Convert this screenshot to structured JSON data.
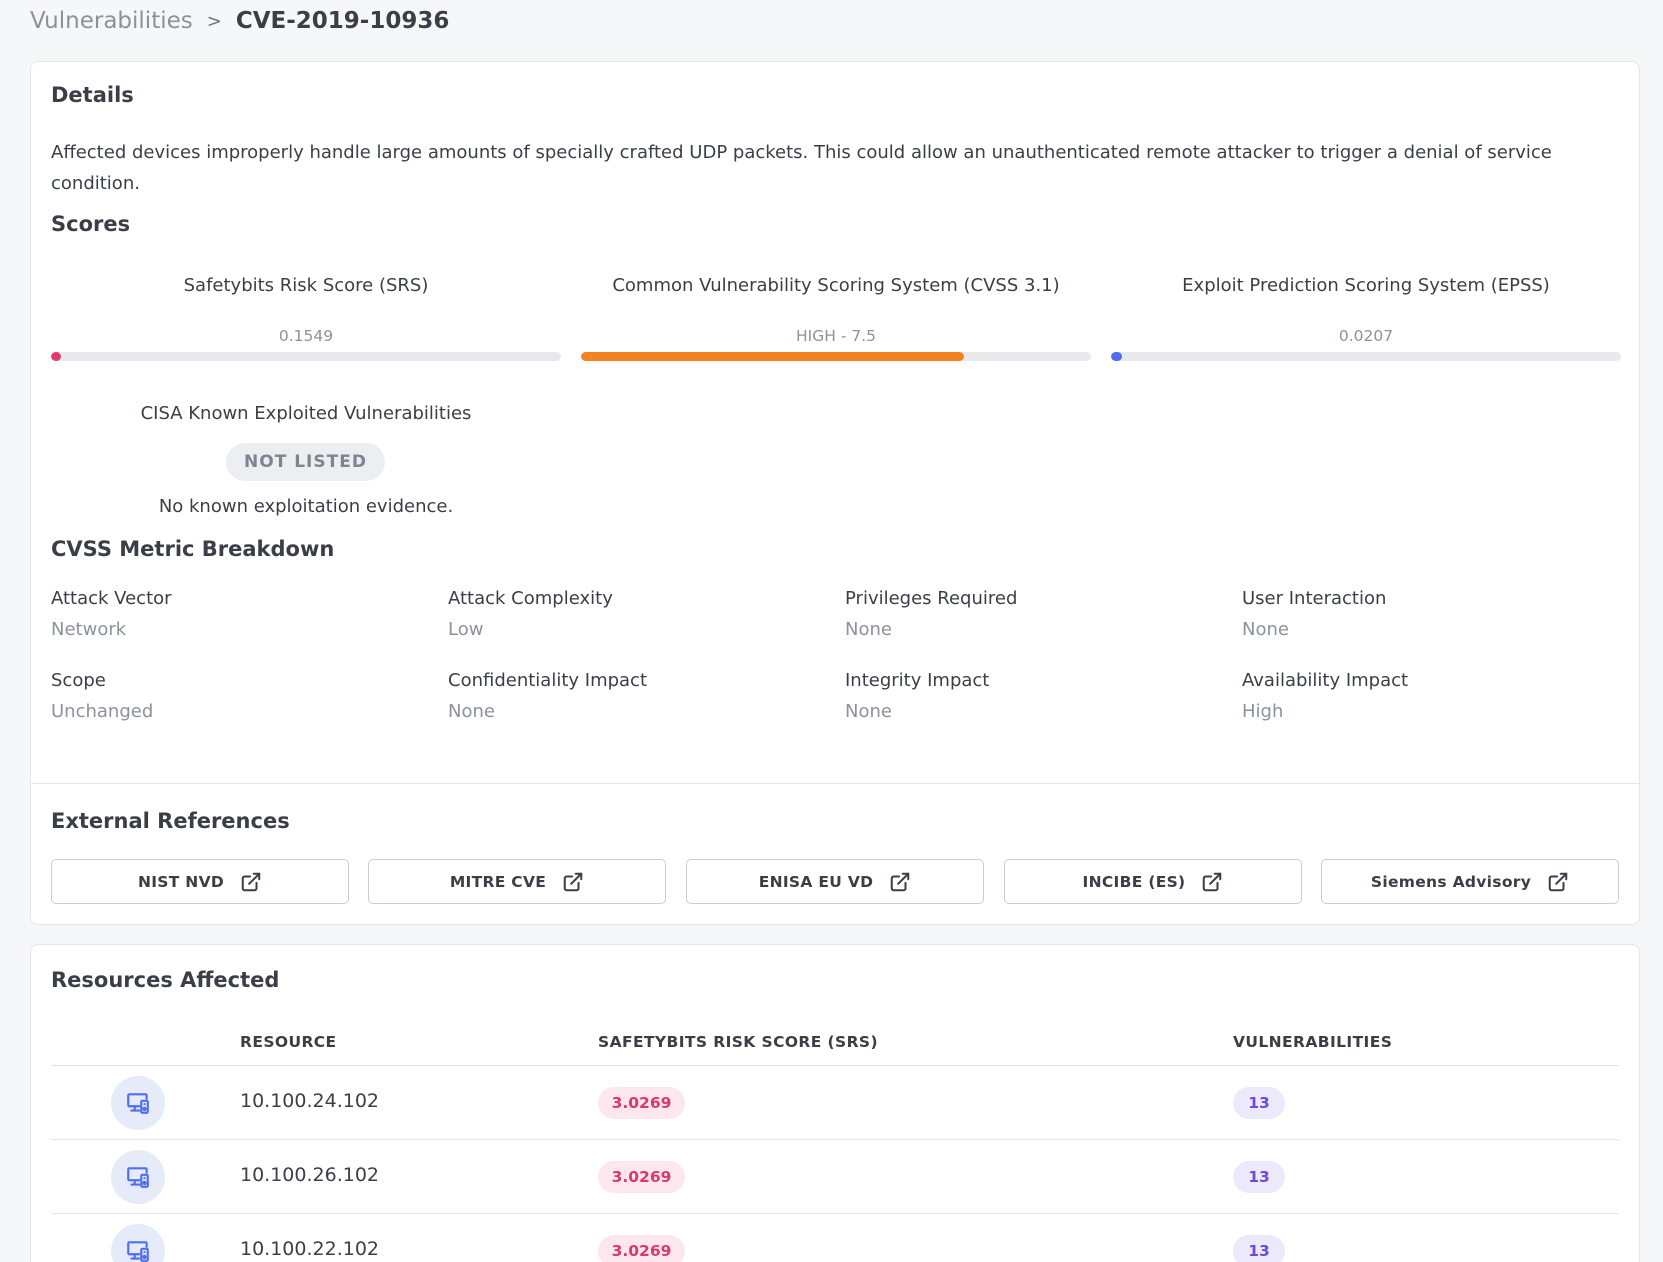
{
  "breadcrumb": {
    "parent": "Vulnerabilities",
    "separator": ">",
    "current": "CVE-2019-10936"
  },
  "details": {
    "heading": "Details",
    "description": "Affected devices improperly handle large amounts of specially crafted UDP packets.  This could allow an unauthenticated remote attacker to trigger a denial of service condition."
  },
  "scores": {
    "heading": "Scores",
    "items": [
      {
        "title": "Safetybits Risk Score (SRS)",
        "value": "0.1549",
        "fraction": 0.0155,
        "color": "#e0396a"
      },
      {
        "title": "Common Vulnerability Scoring System (CVSS 3.1)",
        "value": "HIGH - 7.5",
        "fraction": 0.75,
        "color": "#f58220"
      },
      {
        "title": "Exploit Prediction Scoring System (EPSS)",
        "value": "0.0207",
        "fraction": 0.0207,
        "color": "#4f6ef2"
      }
    ]
  },
  "cisa": {
    "title": "CISA Known Exploited Vulnerabilities",
    "status": "NOT LISTED",
    "note": "No known exploitation evidence."
  },
  "cvss": {
    "heading": "CVSS Metric Breakdown",
    "metrics": [
      {
        "label": "Attack Vector",
        "value": "Network"
      },
      {
        "label": "Attack Complexity",
        "value": "Low"
      },
      {
        "label": "Privileges Required",
        "value": "None"
      },
      {
        "label": "User Interaction",
        "value": "None"
      },
      {
        "label": "Scope",
        "value": "Unchanged"
      },
      {
        "label": "Confidentiality Impact",
        "value": "None"
      },
      {
        "label": "Integrity Impact",
        "value": "None"
      },
      {
        "label": "Availability Impact",
        "value": "High"
      }
    ]
  },
  "references": {
    "heading": "External References",
    "items": [
      {
        "label": "NIST NVD",
        "icon": "external-link-icon"
      },
      {
        "label": "MITRE CVE",
        "icon": "external-link-icon"
      },
      {
        "label": "ENISA EU VD",
        "icon": "external-link-icon"
      },
      {
        "label": "INCIBE (ES)",
        "icon": "external-link-icon"
      },
      {
        "label": "Siemens Advisory",
        "icon": "external-link-icon"
      }
    ]
  },
  "resources": {
    "heading": "Resources Affected",
    "columns": [
      "RESOURCE",
      "SAFETYBITS RISK SCORE (SRS)",
      "VULNERABILITIES"
    ],
    "rows": [
      {
        "resource": "10.100.24.102",
        "srs": "3.0269",
        "vulnerabilities": "13",
        "icon": "device-icon"
      },
      {
        "resource": "10.100.26.102",
        "srs": "3.0269",
        "vulnerabilities": "13",
        "icon": "device-icon"
      },
      {
        "resource": "10.100.22.102",
        "srs": "3.0269",
        "vulnerabilities": "13",
        "icon": "device-icon"
      }
    ]
  }
}
